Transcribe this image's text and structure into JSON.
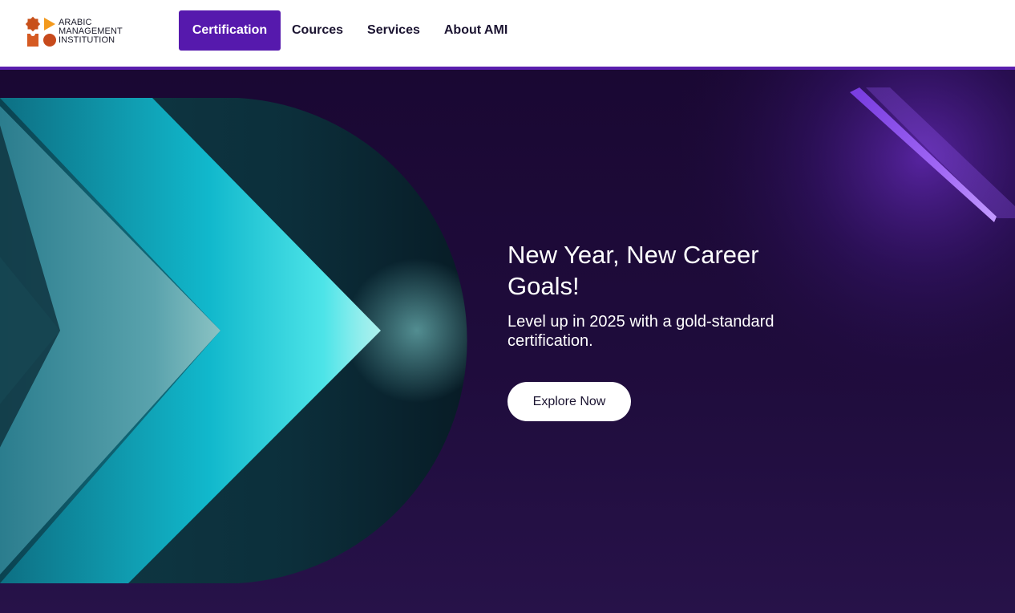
{
  "brand": {
    "logo_lines": [
      "ARABIC",
      "MANAGEMENT",
      "INSTITUTION"
    ],
    "logo_colors": {
      "star": "#c8501a",
      "triangle": "#f39a1e",
      "square": "#d55a22",
      "circle": "#c74a1c"
    }
  },
  "nav": {
    "items": [
      {
        "label": "Certification",
        "active": true
      },
      {
        "label": "Cources",
        "active": false
      },
      {
        "label": "Services",
        "active": false
      },
      {
        "label": "About AMI",
        "active": false
      }
    ],
    "accent": "#5619ad"
  },
  "hero": {
    "title": "New Year, New Career Goals!",
    "subtitle": "Level up in 2025 with a gold-standard certification.",
    "cta_label": "Explore Now",
    "colors": {
      "background": "#1c0a36",
      "chevron_teal": "#14c9d6",
      "glow_purple": "#8b4ae0"
    }
  }
}
